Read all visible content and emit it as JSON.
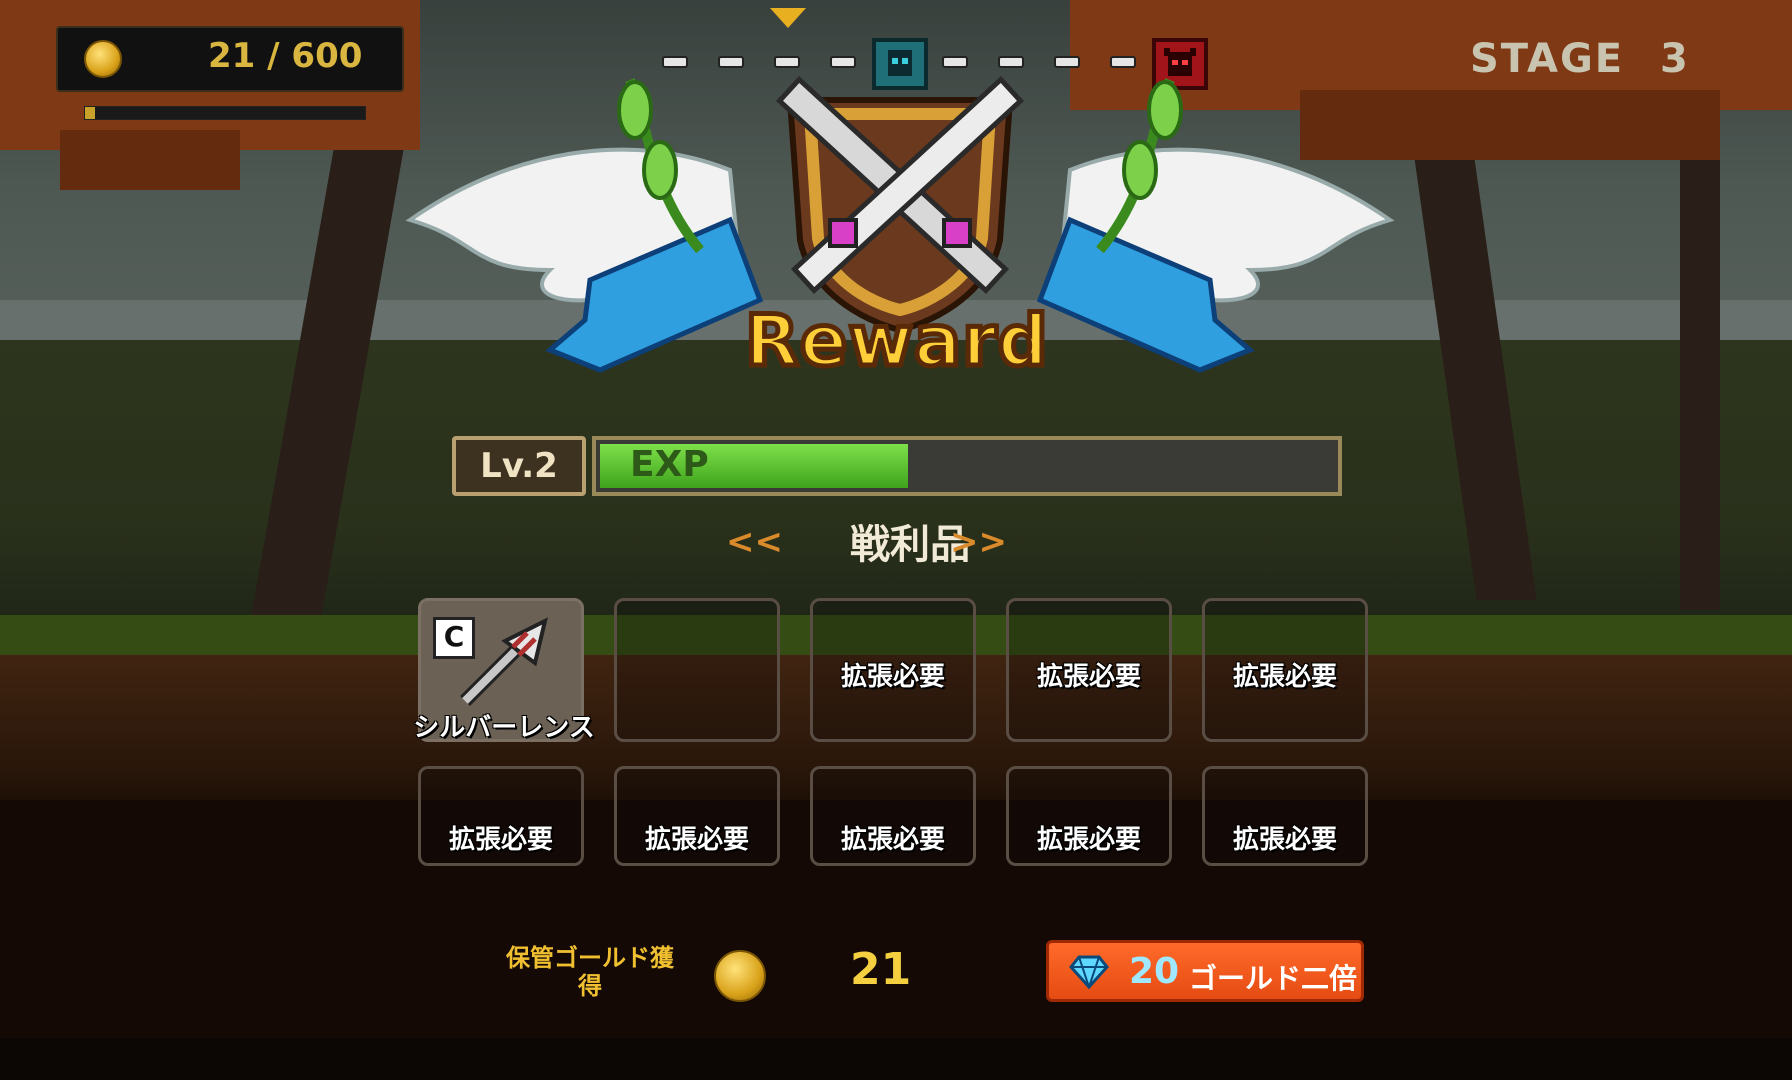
{
  "hud": {
    "gold_display": "21 / 600",
    "gold_progress": 0.035,
    "stage_label": "STAGE",
    "stage_number": "3"
  },
  "stage_progress": {
    "node_count": 10,
    "current_node_icon": "blue-helmet-icon",
    "boss_node_icon": "red-devil-icon"
  },
  "reward": {
    "title": "Reward",
    "level_label": "Lv.2",
    "exp_label": "EXP",
    "exp_progress": 0.42
  },
  "loot": {
    "title": "戦利品",
    "slots": [
      {
        "label": "シルバーレンス",
        "grade": "C",
        "icon": "silver-lance-icon",
        "filled": true
      },
      {
        "label": "",
        "filled": false
      },
      {
        "label": "拡張必要",
        "filled": false
      },
      {
        "label": "拡張必要",
        "filled": false
      },
      {
        "label": "拡張必要",
        "filled": false
      },
      {
        "label": "拡張必要",
        "filled": false
      },
      {
        "label": "拡張必要",
        "filled": false
      },
      {
        "label": "拡張必要",
        "filled": false
      },
      {
        "label": "拡張必要",
        "filled": false
      },
      {
        "label": "拡張必要",
        "filled": false
      }
    ]
  },
  "footer": {
    "stored_gold_label_line1": "保管ゴールド獲",
    "stored_gold_label_line2": "得",
    "stored_gold_value": "21",
    "double_button_cost": "20",
    "double_button_label": "ゴールド二倍"
  },
  "colors": {
    "accent_gold": "#f4d040",
    "button_orange": "#e54b12",
    "exp_green": "#5cc42e"
  }
}
